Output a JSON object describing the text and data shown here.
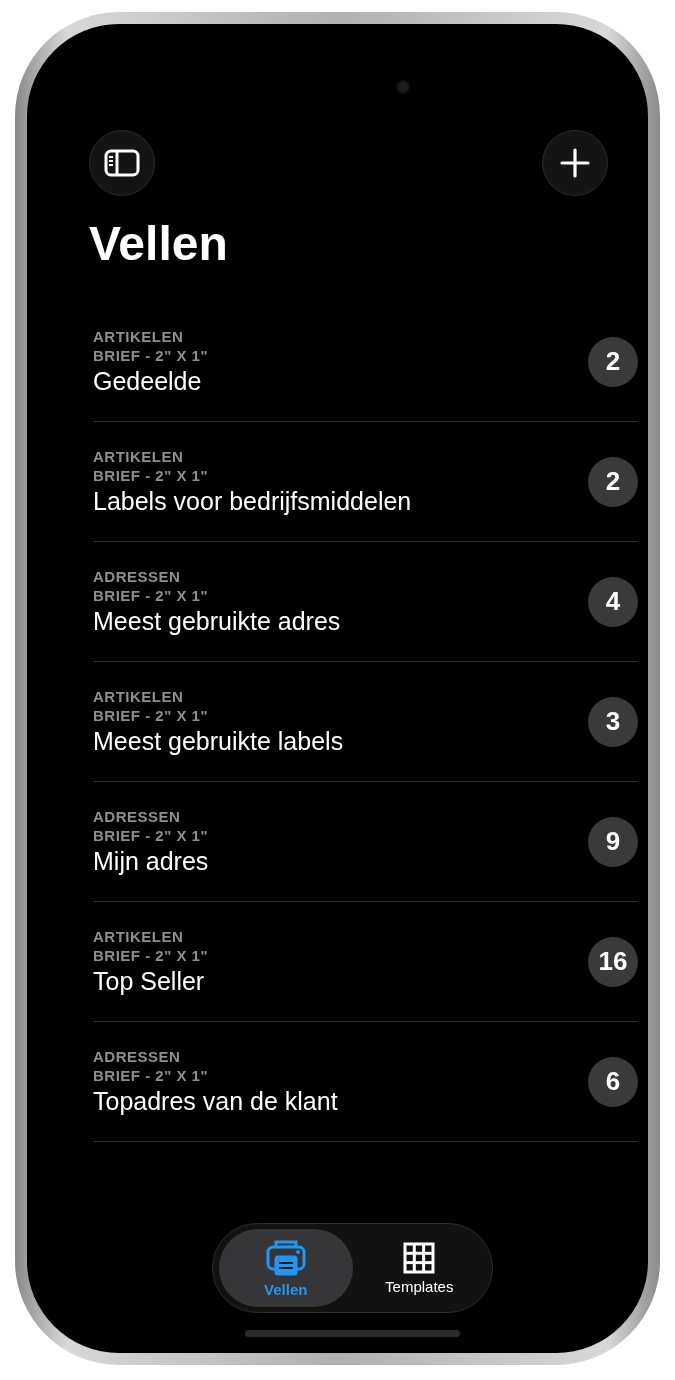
{
  "title": "Vellen",
  "sheets": [
    {
      "category": "ARTIKELEN",
      "size": "BRIEF - 2\" X 1\"",
      "name": "Gedeelde",
      "count": "2"
    },
    {
      "category": "ARTIKELEN",
      "size": "BRIEF - 2\" X 1\"",
      "name": "Labels voor bedrijfsmiddelen",
      "count": "2"
    },
    {
      "category": "ADRESSEN",
      "size": "BRIEF - 2\" X 1\"",
      "name": "Meest gebruikte adres",
      "count": "4"
    },
    {
      "category": "ARTIKELEN",
      "size": "BRIEF - 2\" X 1\"",
      "name": "Meest gebruikte labels",
      "count": "3"
    },
    {
      "category": "ADRESSEN",
      "size": "BRIEF - 2\" X 1\"",
      "name": "Mijn adres",
      "count": "9"
    },
    {
      "category": "ARTIKELEN",
      "size": "BRIEF - 2\" X 1\"",
      "name": "Top Seller",
      "count": "16"
    },
    {
      "category": "ADRESSEN",
      "size": "BRIEF - 2\" X 1\"",
      "name": "Topadres van de klant",
      "count": "6"
    }
  ],
  "tabs": [
    {
      "label": "Vellen",
      "kind": "printer",
      "selected": true
    },
    {
      "label": "Templates",
      "kind": "grid",
      "selected": false
    }
  ]
}
